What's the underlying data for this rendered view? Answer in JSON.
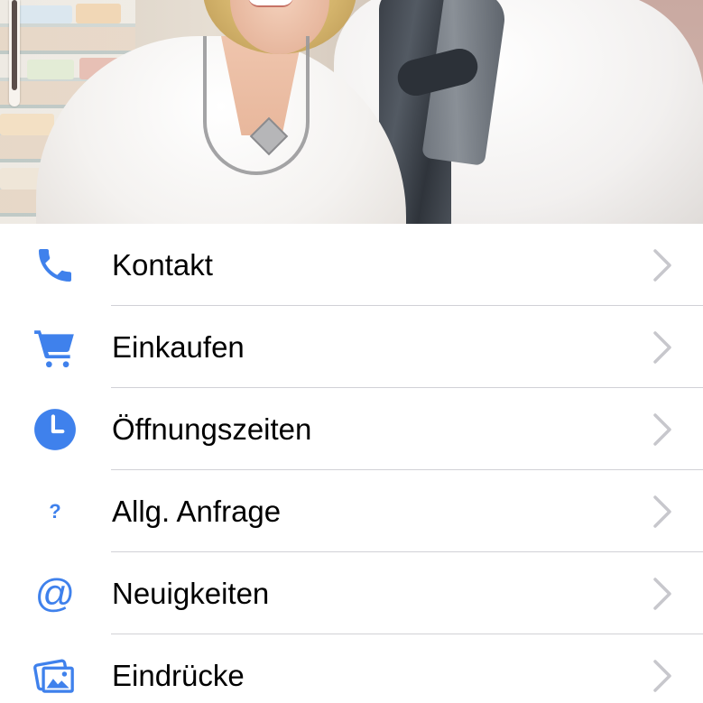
{
  "theme": {
    "accent": "#3f81ec",
    "chevron": "#c7c7cc",
    "separator": "#d1d1d6",
    "label": "#000000",
    "background": "#ffffff"
  },
  "hero": {
    "description_icon": "photo-icon"
  },
  "menu": {
    "items": [
      {
        "label": "Kontakt",
        "icon": "phone-icon"
      },
      {
        "label": "Einkaufen",
        "icon": "cart-icon"
      },
      {
        "label": "Öffnungszeiten",
        "icon": "clock-icon"
      },
      {
        "label": "Allg. Anfrage",
        "icon": "question-icon"
      },
      {
        "label": "Neuigkeiten",
        "icon": "at-icon"
      },
      {
        "label": "Eindrücke",
        "icon": "photos-icon"
      }
    ]
  }
}
